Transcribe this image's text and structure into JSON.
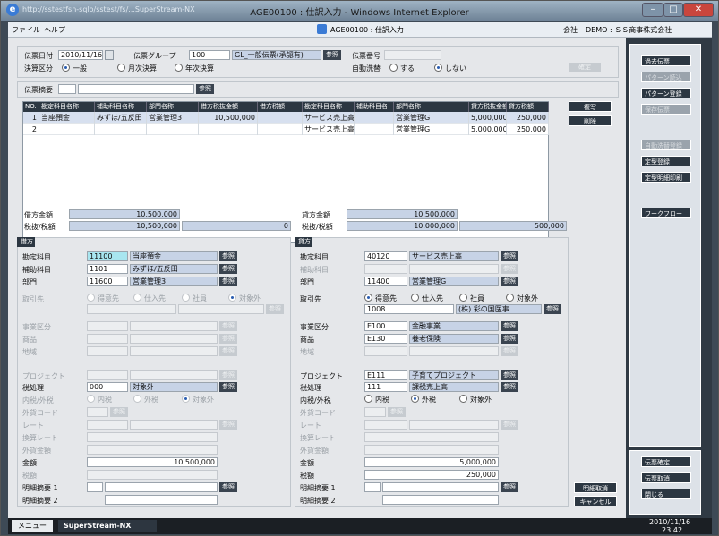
{
  "window": {
    "title": "AGE00100 : 仕訳入力 - Windows Internet Explorer",
    "url": "http://sstestfsn-sqlo/sstest/fs/...SuperStream-NX",
    "min": "–",
    "max": "□",
    "close": "✕"
  },
  "menu": {
    "file": "ファイル",
    "help": "ヘルプ",
    "screen": "AGE00100 : 仕訳入力",
    "company_label": "会社",
    "company_value": "DEMO : ＳＳ商事株式会社"
  },
  "header": {
    "date_label": "伝票日付",
    "date_value": "2010/11/16",
    "group_label": "伝票グループ",
    "group_code": "100",
    "group_name": "GL_一般伝票(承認有)",
    "number_label": "伝票番号",
    "number_value": "",
    "settle_label": "決算区分",
    "settle_opts": [
      "一般",
      "月次決算",
      "年次決算"
    ],
    "auto_label": "自動洗替",
    "auto_opts": [
      "する",
      "しない"
    ],
    "confirm_btn": "確定",
    "memo_label": "伝票摘要",
    "memo_value": "",
    "ref": "参照"
  },
  "grid": {
    "headers": [
      "NO.",
      "勘定科目名称",
      "補助科目名称",
      "部門名称",
      "借方税抜金額",
      "借方税額",
      "勘定科目名称",
      "補助科目名",
      "部門名称",
      "貸方税抜金額",
      "貸方税額"
    ],
    "rows": [
      [
        "1",
        "当座預金",
        "みずほ/五反田",
        "営業管理3",
        "10,500,000",
        "",
        "サービス売上高",
        "",
        "営業管理G",
        "5,000,000",
        "250,000"
      ],
      [
        "2",
        "",
        "",
        "",
        "",
        "",
        "サービス売上高",
        "",
        "営業管理G",
        "5,000,000",
        "250,000"
      ]
    ],
    "copy_btn": "複写",
    "delete_btn": "削除"
  },
  "totals": {
    "debit_label": "借方金額",
    "debit_value": "10,500,000",
    "debit_tax_label": "税抜/税額",
    "debit_net": "10,500,000",
    "debit_tax": "0",
    "credit_label": "貸方金額",
    "credit_value": "10,500,000",
    "credit_tax_label": "税抜/税額",
    "credit_net": "10,000,000",
    "credit_tax": "500,000"
  },
  "debit": {
    "title": "借方",
    "acct_label": "勘定科目",
    "acct_code": "11100",
    "acct_name": "当座預金",
    "sub_label": "補助科目",
    "sub_code": "1101",
    "sub_name": "みずほ/五反田",
    "dept_label": "部門",
    "dept_code": "11600",
    "dept_name": "営業管理3",
    "partner_label": "取引先",
    "partner_opts": [
      "得意先",
      "仕入先",
      "社員",
      "対象外"
    ],
    "biz_label": "事業区分",
    "item_label": "商品",
    "region_label": "地域",
    "project_label": "プロジェクト",
    "taxproc_label": "税処理",
    "taxproc_code": "000",
    "taxproc_name": "対象外",
    "inout_label": "内税/外税",
    "inout_opts": [
      "内税",
      "外税",
      "対象外"
    ],
    "fx_label": "外貨コード",
    "rate_label": "レート",
    "conv_label": "換算レート",
    "fxamt_label": "外貨金額",
    "amount_label": "金額",
    "amount_value": "10,500,000",
    "tax_label": "税額",
    "memo1_label": "明細摘要 1",
    "memo2_label": "明細摘要 2"
  },
  "credit": {
    "title": "貸方",
    "acct_label": "勘定科目",
    "acct_code": "40120",
    "acct_name": "サービス売上高",
    "sub_label": "補助科目",
    "sub_code": "",
    "sub_name": "",
    "dept_label": "部門",
    "dept_code": "11400",
    "dept_name": "営業管理G",
    "partner_label": "取引先",
    "partner_opts": [
      "得意先",
      "仕入先",
      "社員",
      "対象外"
    ],
    "partner_code": "1008",
    "partner_name": "(株) 彩の国医事",
    "biz_label": "事業区分",
    "biz_code": "E100",
    "biz_name": "金融事業",
    "item_label": "商品",
    "item_code": "E130",
    "item_name": "養老保険",
    "region_label": "地域",
    "project_label": "プロジェクト",
    "project_code": "E111",
    "project_name": "子育てプロジェクト",
    "taxproc_label": "税処理",
    "taxproc_code": "111",
    "taxproc_name": "課税売上高",
    "inout_label": "内税/外税",
    "inout_opts": [
      "内税",
      "外税",
      "対象外"
    ],
    "fx_label": "外貨コード",
    "rate_label": "レート",
    "conv_label": "換算レート",
    "fxamt_label": "外貨金額",
    "amount_label": "金額",
    "amount_value": "5,000,000",
    "tax_label": "税額",
    "tax_value": "250,000",
    "memo1_label": "明細摘要 1",
    "memo2_label": "明細摘要 2"
  },
  "actions": {
    "clear_detail": "明細取消",
    "cancel": "キャンセル"
  },
  "side": {
    "buttons": [
      "過去伝票",
      "パターン読込",
      "パターン登録",
      "保存伝票",
      "自動洗替登録",
      "定型登録",
      "定型明細印刷",
      "ワークフロー"
    ],
    "bottom": [
      "伝票確定",
      "伝票取消",
      "閉じる"
    ]
  },
  "taskbar": {
    "menu": "メニュー",
    "app": "SuperStream-NX",
    "date": "2010/11/16",
    "time": "23:42"
  }
}
